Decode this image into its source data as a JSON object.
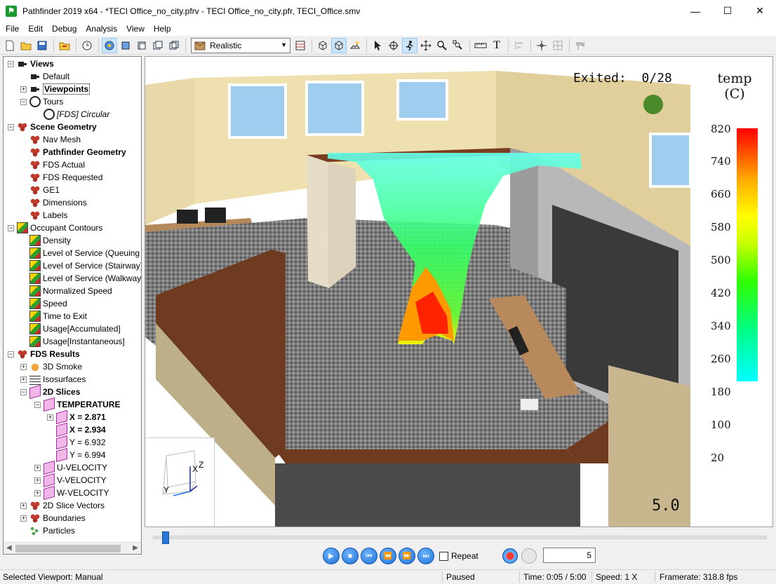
{
  "window": {
    "title": "Pathfinder 2019 x64 - *TECI Office_no_city.pfrv - TECI Office_no_city.pfr, TECI_Office.smv",
    "minimize": "—",
    "maximize": "☐",
    "close": "✕"
  },
  "menu": [
    "File",
    "Edit",
    "Debug",
    "Analysis",
    "View",
    "Help"
  ],
  "toolbar": {
    "render_mode": "Realistic",
    "icons": [
      "new-file-icon",
      "open-folder-icon",
      "save-icon",
      "import-icon",
      "timer-icon",
      "orbit-icon",
      "view-front-icon",
      "view-top-icon",
      "view-side-icon",
      "view-iso-icon",
      "wireframe-icon",
      "solid-icon",
      "smooth-icon",
      "select-pointer-icon",
      "move-icon",
      "walk-icon",
      "pan-icon",
      "zoom-icon",
      "zoom-fit-icon",
      "measure-icon",
      "text-icon",
      "align-icon",
      "center-icon",
      "snap-icon",
      "scene-icon"
    ]
  },
  "tree": [
    {
      "label": "Views",
      "bold": true,
      "icon": "camera-icon",
      "exp": "−"
    },
    {
      "label": "Default",
      "icon": "camera-icon"
    },
    {
      "label": "Viewpoints",
      "bold": true,
      "icon": "camera-icon",
      "exp": "+",
      "selected": true
    },
    {
      "label": "Tours",
      "icon": "tour-icon",
      "exp": "−"
    },
    {
      "label": "[FDS] Circular",
      "italic": true,
      "icon": "tour-icon"
    },
    {
      "label": "Scene Geometry",
      "bold": true,
      "icon": "geometry-icon",
      "exp": "−"
    },
    {
      "label": "Nav Mesh",
      "icon": "geometry-icon"
    },
    {
      "label": "Pathfinder Geometry",
      "bold": true,
      "icon": "geometry-icon"
    },
    {
      "label": "FDS Actual",
      "icon": "geometry-icon"
    },
    {
      "label": "FDS Requested",
      "icon": "geometry-icon"
    },
    {
      "label": "GE1",
      "icon": "geometry-icon"
    },
    {
      "label": "Dimensions",
      "icon": "geometry-icon"
    },
    {
      "label": "Labels",
      "icon": "geometry-icon"
    },
    {
      "label": "Occupant Contours",
      "icon": "contour-icon",
      "exp": "−"
    },
    {
      "label": "Density",
      "icon": "contour-icon"
    },
    {
      "label": "Level of Service (Queuing",
      "icon": "contour-icon"
    },
    {
      "label": "Level of Service (Stairway)",
      "icon": "contour-icon"
    },
    {
      "label": "Level of Service (Walkway",
      "icon": "contour-icon"
    },
    {
      "label": "Normalized Speed",
      "icon": "contour-icon"
    },
    {
      "label": "Speed",
      "icon": "contour-icon"
    },
    {
      "label": "Time to Exit",
      "icon": "contour-icon"
    },
    {
      "label": "Usage[Accumulated]",
      "icon": "contour-icon"
    },
    {
      "label": "Usage[Instantaneous]",
      "icon": "contour-icon"
    },
    {
      "label": "FDS Results",
      "bold": true,
      "icon": "geometry-icon",
      "exp": "−"
    },
    {
      "label": "3D Smoke",
      "icon": "smoke-icon",
      "exp": "+"
    },
    {
      "label": "Isosurfaces",
      "icon": "isosurface-icon",
      "exp": "+"
    },
    {
      "label": "2D Slices",
      "bold": true,
      "icon": "slice-icon",
      "exp": "−"
    },
    {
      "label": "TEMPERATURE",
      "bold": true,
      "icon": "slice-icon",
      "exp": "−"
    },
    {
      "label": "X = 2.871",
      "bold": true,
      "icon": "slice-icon",
      "exp": "+"
    },
    {
      "label": "X = 2.934",
      "bold": true,
      "icon": "slice-icon"
    },
    {
      "label": "Y = 6.932",
      "icon": "slice-icon"
    },
    {
      "label": "Y = 6.994",
      "icon": "slice-icon"
    },
    {
      "label": "U-VELOCITY",
      "icon": "slice-icon",
      "exp": "+"
    },
    {
      "label": "V-VELOCITY",
      "icon": "slice-icon",
      "exp": "+"
    },
    {
      "label": "W-VELOCITY",
      "icon": "slice-icon",
      "exp": "+"
    },
    {
      "label": "2D Slice Vectors",
      "icon": "geometry-icon",
      "exp": "+"
    },
    {
      "label": "Boundaries",
      "icon": "geometry-icon",
      "exp": "+"
    },
    {
      "label": "Particles",
      "icon": "particles-icon"
    }
  ],
  "viewport": {
    "exited_label": "Exited:",
    "exited_value": "0/28",
    "time_readout": "5.0",
    "legend_title_line1": "temp",
    "legend_title_line2": "(C)",
    "legend_ticks": [
      "820",
      "740",
      "660",
      "580",
      "500",
      "420",
      "340",
      "260",
      "180",
      "100",
      "20"
    ],
    "axis_labels": {
      "x": "X",
      "y": "Y",
      "z": "Z"
    }
  },
  "playback": {
    "repeat_label": "Repeat",
    "repeat_checked": false,
    "frame": "5",
    "timeline_position_fraction": 0.0
  },
  "status": {
    "viewport": "Selected Viewport: Manual",
    "state": "Paused",
    "time": "Time: 0:05 / 5:00",
    "speed": "Speed: 1 X",
    "framerate": "Framerate: 318.8 fps"
  }
}
